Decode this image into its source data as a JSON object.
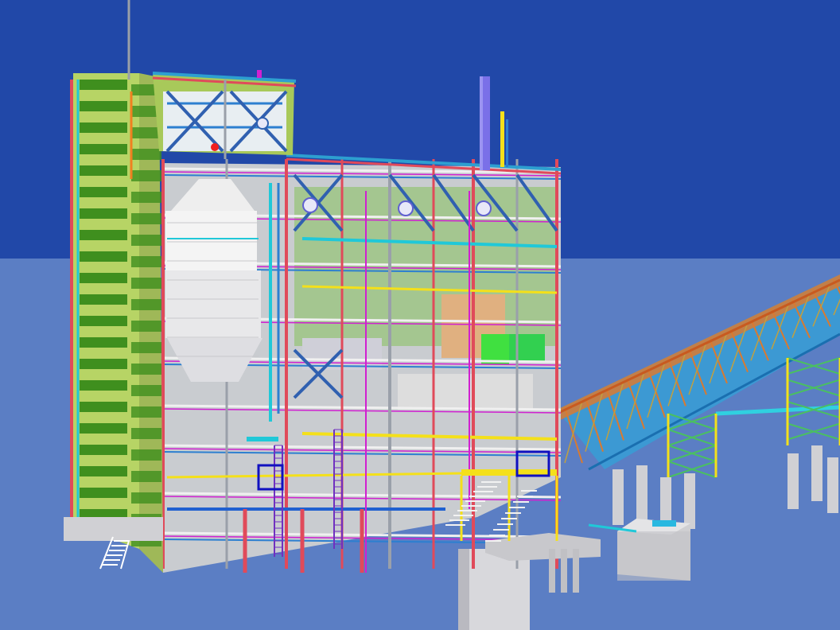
{
  "viewport": {
    "sky_color": "#2148a8",
    "ground_color": "#5b7ec4"
  },
  "model": {
    "palette": {
      "tower_green_dark": "#3f8f1e",
      "tower_green_light": "#b7d465",
      "facade_green": "#a8c95a",
      "steel_gray": "#c9ccd0",
      "column_red": "#e04a5a",
      "beam_blue": "#2d7fd0",
      "pipe_cyan": "#20c8d8",
      "pipe_magenta": "#d020d0",
      "pipe_yellow": "#f4e01a",
      "stair_white": "#f2f2f2",
      "vessel_white": "#eeeeee",
      "orange": "#f08020",
      "lime": "#40e040",
      "conveyor_orange": "#d97a30",
      "conveyor_cyan": "#22aee0",
      "stack_purple": "#7a70e8"
    },
    "components": [
      {
        "name": "stair-tower"
      },
      {
        "name": "main-building"
      },
      {
        "name": "upper-penthouse"
      },
      {
        "name": "exhaust-stack"
      },
      {
        "name": "process-vessel"
      },
      {
        "name": "conveyor-gallery"
      },
      {
        "name": "conveyor-support-trestle"
      },
      {
        "name": "access-platform"
      },
      {
        "name": "concrete-pier"
      },
      {
        "name": "electrical-enclosure"
      }
    ]
  }
}
